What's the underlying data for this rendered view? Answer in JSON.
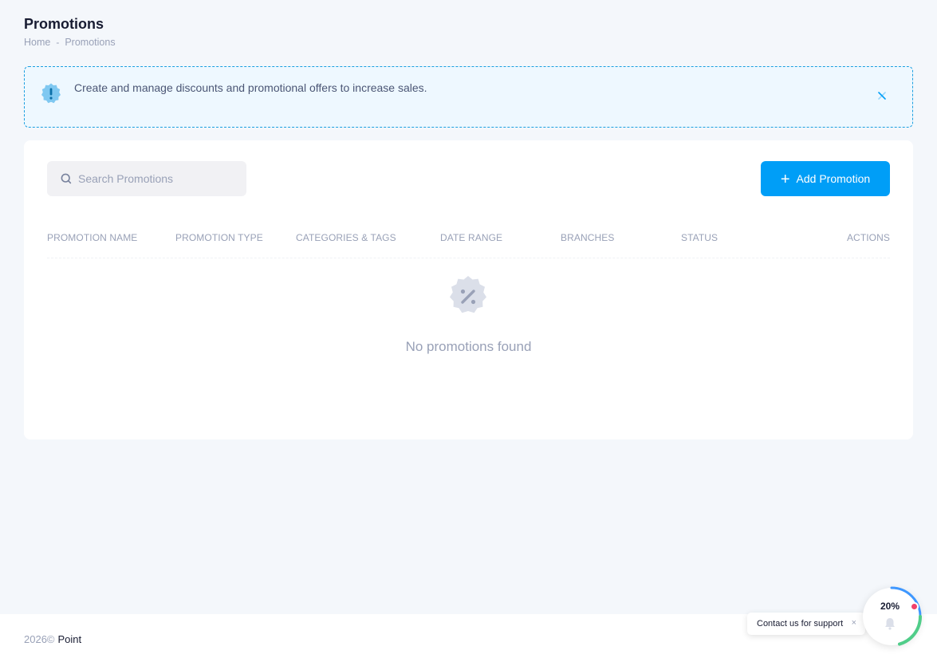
{
  "header": {
    "title": "Promotions",
    "breadcrumb": {
      "home": "Home",
      "separator": "-",
      "current": "Promotions"
    }
  },
  "notice": {
    "text": "Create and manage discounts and promotional offers to increase sales.",
    "icon": "exclamation-badge-icon",
    "color": "#1b9fe0"
  },
  "search": {
    "placeholder": "Search Promotions",
    "value": ""
  },
  "add_button": {
    "label": "Add Promotion",
    "icon": "plus-icon",
    "color": "#009ef7"
  },
  "table": {
    "columns": [
      "Promotion Name",
      "Promotion Type",
      "Categories & Tags",
      "Date Range",
      "Branches",
      "Status",
      "Actions"
    ],
    "rows": []
  },
  "empty_state": {
    "text": "No promotions found",
    "icon": "percent-badge-icon"
  },
  "footer": {
    "year": "2026©",
    "brand": "Point"
  },
  "support": {
    "bubble_text": "Contact us for support",
    "close": "×",
    "progress_label": "20%",
    "progress": 0.2
  }
}
